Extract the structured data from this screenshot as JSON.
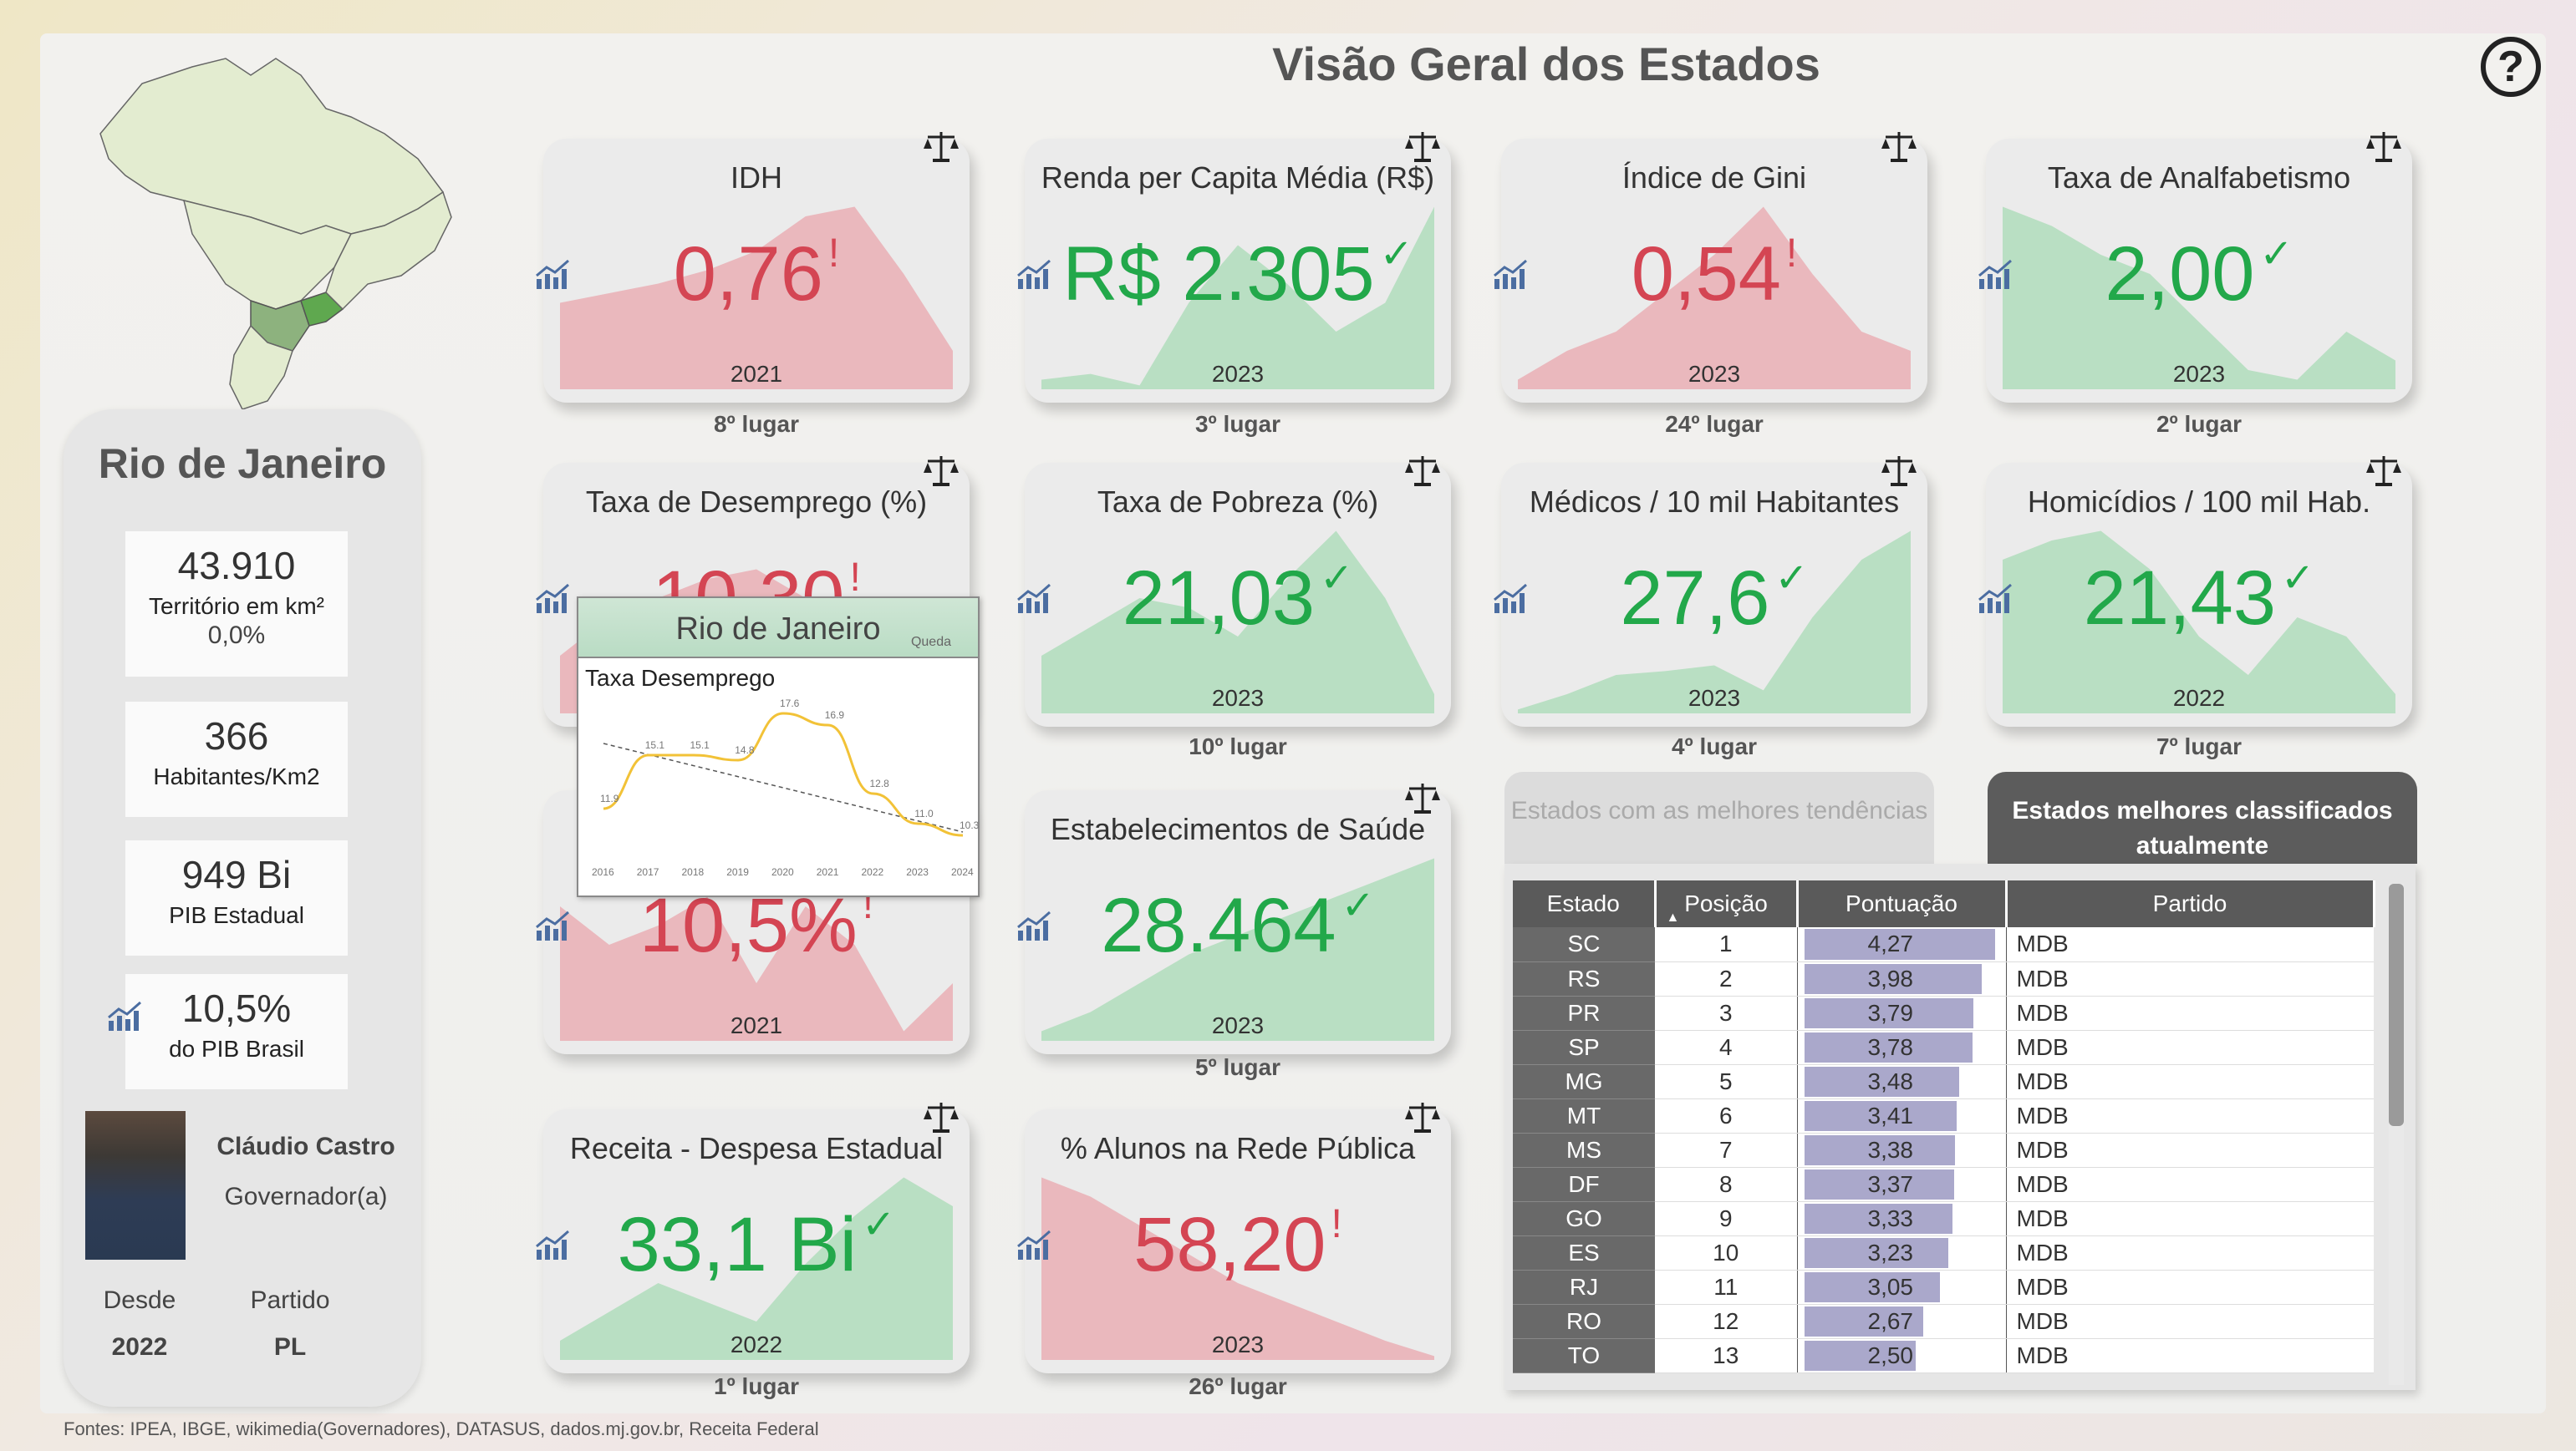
{
  "title": "Visão Geral dos Estados",
  "help_label": "?",
  "state": {
    "name": "Rio de Janeiro",
    "territory": {
      "value": "43.910",
      "label": "Território em km²",
      "change": "0,0%"
    },
    "density": {
      "value": "366",
      "label": "Habitantes/Km2"
    },
    "gdp": {
      "value": "949 Bi",
      "label": "PIB Estadual"
    },
    "gdp_share": {
      "value": "10,5%",
      "label": "do PIB Brasil"
    }
  },
  "governor": {
    "name": "Cláudio Castro",
    "role": "Governador(a)",
    "since_label": "Desde",
    "since": "2022",
    "party_label": "Partido",
    "party": "PL"
  },
  "cards": [
    {
      "title": "IDH",
      "value": "0,76",
      "mark": "!",
      "status": "bad",
      "year": "2021",
      "rank": "8º lugar",
      "series": [
        0.45,
        0.5,
        0.55,
        0.62,
        0.72,
        0.9,
        0.95,
        0.6,
        0.2
      ]
    },
    {
      "title": "Renda per Capita Média (R$)",
      "value": "R$ 2.305",
      "mark": "✓",
      "status": "good",
      "year": "2023",
      "rank": "3º lugar",
      "series": [
        0.05,
        0.08,
        0.02,
        0.45,
        0.75,
        0.55,
        0.3,
        0.45,
        0.95
      ]
    },
    {
      "title": "Índice de Gini",
      "value": "0,54",
      "mark": "!",
      "status": "bad",
      "year": "2023",
      "rank": "24º lugar",
      "series": [
        0.05,
        0.2,
        0.3,
        0.5,
        0.7,
        0.95,
        0.6,
        0.3,
        0.2
      ]
    },
    {
      "title": "Taxa de Analfabetismo",
      "value": "2,00",
      "mark": "✓",
      "status": "good",
      "year": "2023",
      "rank": "2º lugar",
      "series": [
        0.95,
        0.85,
        0.7,
        0.6,
        0.35,
        0.1,
        0.05,
        0.3,
        0.15
      ]
    },
    {
      "title": "Taxa de Desemprego (%)",
      "value": "10,30",
      "mark": "!",
      "status": "bad",
      "year": "",
      "rank": "",
      "series": [
        0.3,
        0.5,
        0.6,
        0.7,
        0.75,
        0.6,
        0.45,
        0.4,
        0.35
      ]
    },
    {
      "title": "Taxa de Pobreza (%)",
      "value": "21,03",
      "mark": "✓",
      "status": "good",
      "year": "2023",
      "rank": "10º lugar",
      "series": [
        0.3,
        0.45,
        0.6,
        0.55,
        0.4,
        0.7,
        0.95,
        0.6,
        0.1
      ]
    },
    {
      "title": "Médicos / 10 mil Habitantes",
      "value": "27,6",
      "mark": "✓",
      "status": "good",
      "year": "2023",
      "rank": "4º lugar",
      "series": [
        0.02,
        0.1,
        0.2,
        0.22,
        0.25,
        0.12,
        0.5,
        0.8,
        0.95
      ]
    },
    {
      "title": "Homicídios / 100 mil Hab.",
      "value": "21,43",
      "mark": "✓",
      "status": "good",
      "year": "2022",
      "rank": "7º lugar",
      "series": [
        0.8,
        0.9,
        0.95,
        0.75,
        0.4,
        0.2,
        0.5,
        0.4,
        0.1
      ]
    },
    {
      "title": "",
      "value": "10,5%",
      "mark": "!",
      "status": "bad",
      "year": "2021",
      "rank": "",
      "series": [
        0.7,
        0.5,
        0.6,
        0.75,
        0.3,
        0.7,
        0.5,
        0.05,
        0.3
      ]
    },
    {
      "title": "Estabelecimentos de Saúde",
      "value": "28.464",
      "mark": "✓",
      "status": "good",
      "year": "2023",
      "rank": "5º lugar",
      "series": [
        0.05,
        0.15,
        0.3,
        0.45,
        0.55,
        0.65,
        0.75,
        0.85,
        0.95
      ]
    },
    {
      "title": "Receita - Despesa Estadual",
      "value": "33,1 Bi",
      "mark": "✓",
      "status": "good",
      "year": "2022",
      "rank": "1º lugar",
      "series": [
        0.1,
        0.25,
        0.4,
        0.3,
        0.2,
        0.5,
        0.75,
        0.95,
        0.8
      ]
    },
    {
      "title": "% Alunos na Rede Pública",
      "value": "58,20",
      "mark": "!",
      "status": "bad",
      "year": "2023",
      "rank": "26º lugar",
      "series": [
        0.95,
        0.85,
        0.7,
        0.55,
        0.4,
        0.3,
        0.2,
        0.1,
        0.02
      ]
    }
  ],
  "tooltip": {
    "title": "Rio de Janeiro",
    "tag": "Queda",
    "chart_title": "Taxa Desemprego",
    "chart_data": {
      "type": "line",
      "x": [
        "2016",
        "2017",
        "2018",
        "2019",
        "2020",
        "2021",
        "2022",
        "2023",
        "2024"
      ],
      "series": [
        {
          "values": [
            11.9,
            15.1,
            15.1,
            14.8,
            17.6,
            16.9,
            12.8,
            11.0,
            10.3
          ]
        }
      ]
    }
  },
  "tabs": {
    "trends": "Estados com as melhores tendências",
    "ranked": "Estados melhores classificados atualmente"
  },
  "table": {
    "headers": [
      "Estado",
      "Posição",
      "Pontuação",
      "Partido"
    ],
    "max_score": 4.27,
    "rows": [
      {
        "uf": "SC",
        "pos": "1",
        "score": "4,27",
        "v": 4.27,
        "party": "MDB"
      },
      {
        "uf": "RS",
        "pos": "2",
        "score": "3,98",
        "v": 3.98,
        "party": "MDB"
      },
      {
        "uf": "PR",
        "pos": "3",
        "score": "3,79",
        "v": 3.79,
        "party": "MDB"
      },
      {
        "uf": "SP",
        "pos": "4",
        "score": "3,78",
        "v": 3.78,
        "party": "MDB"
      },
      {
        "uf": "MG",
        "pos": "5",
        "score": "3,48",
        "v": 3.48,
        "party": "MDB"
      },
      {
        "uf": "MT",
        "pos": "6",
        "score": "3,41",
        "v": 3.41,
        "party": "MDB"
      },
      {
        "uf": "MS",
        "pos": "7",
        "score": "3,38",
        "v": 3.38,
        "party": "MDB"
      },
      {
        "uf": "DF",
        "pos": "8",
        "score": "3,37",
        "v": 3.37,
        "party": "MDB"
      },
      {
        "uf": "GO",
        "pos": "9",
        "score": "3,33",
        "v": 3.33,
        "party": "MDB"
      },
      {
        "uf": "ES",
        "pos": "10",
        "score": "3,23",
        "v": 3.23,
        "party": "MDB"
      },
      {
        "uf": "RJ",
        "pos": "11",
        "score": "3,05",
        "v": 3.05,
        "party": "MDB"
      },
      {
        "uf": "RO",
        "pos": "12",
        "score": "2,67",
        "v": 2.67,
        "party": "MDB"
      },
      {
        "uf": "TO",
        "pos": "13",
        "score": "2,50",
        "v": 2.5,
        "party": "MDB"
      }
    ]
  },
  "colors": {
    "good": "#22a84a",
    "bad": "#d44553",
    "good_fill": "#b9dfc3",
    "bad_fill": "#eab8bd",
    "bar": "#aaa8cb"
  },
  "sources": "Fontes: IPEA, IBGE, wikimedia(Governadores), DATASUS, dados.mj.gov.br, Receita Federal"
}
